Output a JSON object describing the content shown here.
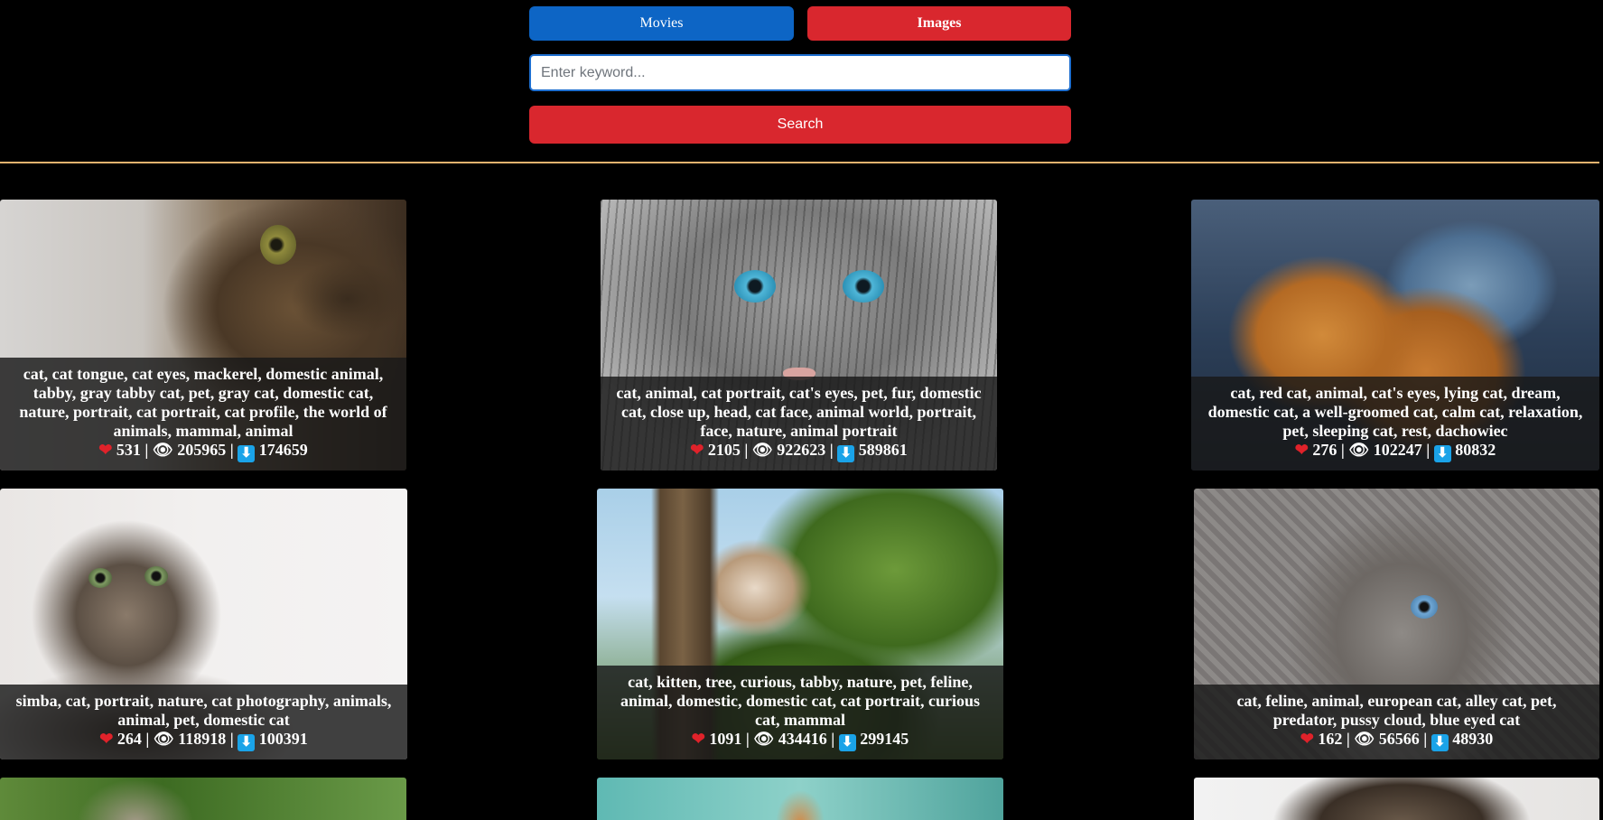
{
  "nav": {
    "movies_label": "Movies",
    "images_label": "Images"
  },
  "search": {
    "placeholder": "Enter keyword...",
    "value": "",
    "button_label": "Search"
  },
  "icons": {
    "like": "heart-icon",
    "views": "eye-icon",
    "downloads": "download-icon"
  },
  "colors": {
    "movies_button": "#0d65c5",
    "images_button": "#d9272e",
    "search_button": "#d9272e",
    "divider": "#e6b36f",
    "background": "#000000"
  },
  "results": [
    {
      "tags": "cat, cat tongue, cat eyes, mackerel, domestic animal, tabby, gray tabby cat, pet, gray cat, domestic cat, nature, portrait, cat portrait, cat profile, the world of animals, mammal, animal",
      "likes": "531",
      "views": "205965",
      "downloads": "174659"
    },
    {
      "tags": "cat, animal, cat portrait, cat's eyes, pet, fur, domestic cat, close up, head, cat face, animal world, portrait, face, nature, animal portrait",
      "likes": "2105",
      "views": "922623",
      "downloads": "589861"
    },
    {
      "tags": "cat, red cat, animal, cat's eyes, lying cat, dream, domestic cat, a well-groomed cat, calm cat, relaxation, pet, sleeping cat, rest, dachowiec",
      "likes": "276",
      "views": "102247",
      "downloads": "80832"
    },
    {
      "tags": "simba, cat, portrait, nature, cat photography, animals, animal, pet, domestic cat",
      "likes": "264",
      "views": "118918",
      "downloads": "100391"
    },
    {
      "tags": "cat, kitten, tree, curious, tabby, nature, pet, feline, animal, domestic, domestic cat, cat portrait, curious cat, mammal",
      "likes": "1091",
      "views": "434416",
      "downloads": "299145"
    },
    {
      "tags": "cat, feline, animal, european cat, alley cat, pet, predator, pussy cloud, blue eyed cat",
      "likes": "162",
      "views": "56566",
      "downloads": "48930"
    }
  ]
}
